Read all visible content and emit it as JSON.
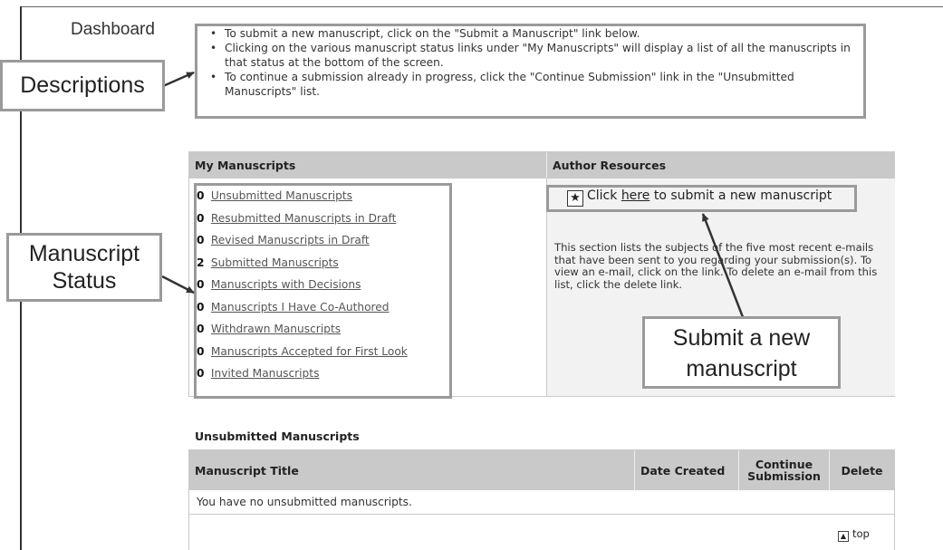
{
  "page": {
    "title": "Dashboard"
  },
  "descriptions": {
    "items": [
      "To submit a new manuscript, click on the \"Submit a Manuscript\" link below.",
      "Clicking on the various manuscript status links under \"My Manuscripts\" will display a list of all the manuscripts in that status at the bottom of the screen.",
      "To continue a submission already in progress, click the \"Continue Submission\" link in the \"Unsubmitted Manuscripts\" list."
    ]
  },
  "callouts": {
    "descriptions": "Descriptions",
    "status_line1": "Manuscript",
    "status_line2": "Status",
    "submit_line1": "Submit a new",
    "submit_line2": "manuscript"
  },
  "my_manuscripts": {
    "heading": "My Manuscripts",
    "items": [
      {
        "count": "0",
        "label": "Unsubmitted Manuscripts"
      },
      {
        "count": "0",
        "label": "Resubmitted Manuscripts in Draft"
      },
      {
        "count": "0",
        "label": "Revised Manuscripts in Draft"
      },
      {
        "count": "2",
        "label": "Submitted Manuscripts"
      },
      {
        "count": "0",
        "label": "Manuscripts with Decisions"
      },
      {
        "count": "0",
        "label": "Manuscripts I Have Co-Authored"
      },
      {
        "count": "0",
        "label": "Withdrawn Manuscripts"
      },
      {
        "count": "0",
        "label": "Manuscripts Accepted for First Look"
      },
      {
        "count": "0",
        "label": "Invited Manuscripts"
      }
    ]
  },
  "author_resources": {
    "heading": "Author Resources",
    "click_prefix": "Click",
    "here_link": "here",
    "click_suffix": "to submit a new manuscript",
    "star_icon": "★",
    "description": "This section lists the subjects of the five most recent e-mails that have been sent to you regarding your submission(s). To view an e-mail, click on the link. To delete an e-mail from this list, click the delete link."
  },
  "unsubmitted": {
    "title": "Unsubmitted Manuscripts",
    "columns": {
      "title": "Manuscript Title",
      "date": "Date Created",
      "continue_line1": "Continue",
      "continue_line2": "Submission",
      "delete": "Delete"
    },
    "empty_message": "You have no unsubmitted manuscripts.",
    "top_icon": "▲",
    "top_label": "top"
  }
}
